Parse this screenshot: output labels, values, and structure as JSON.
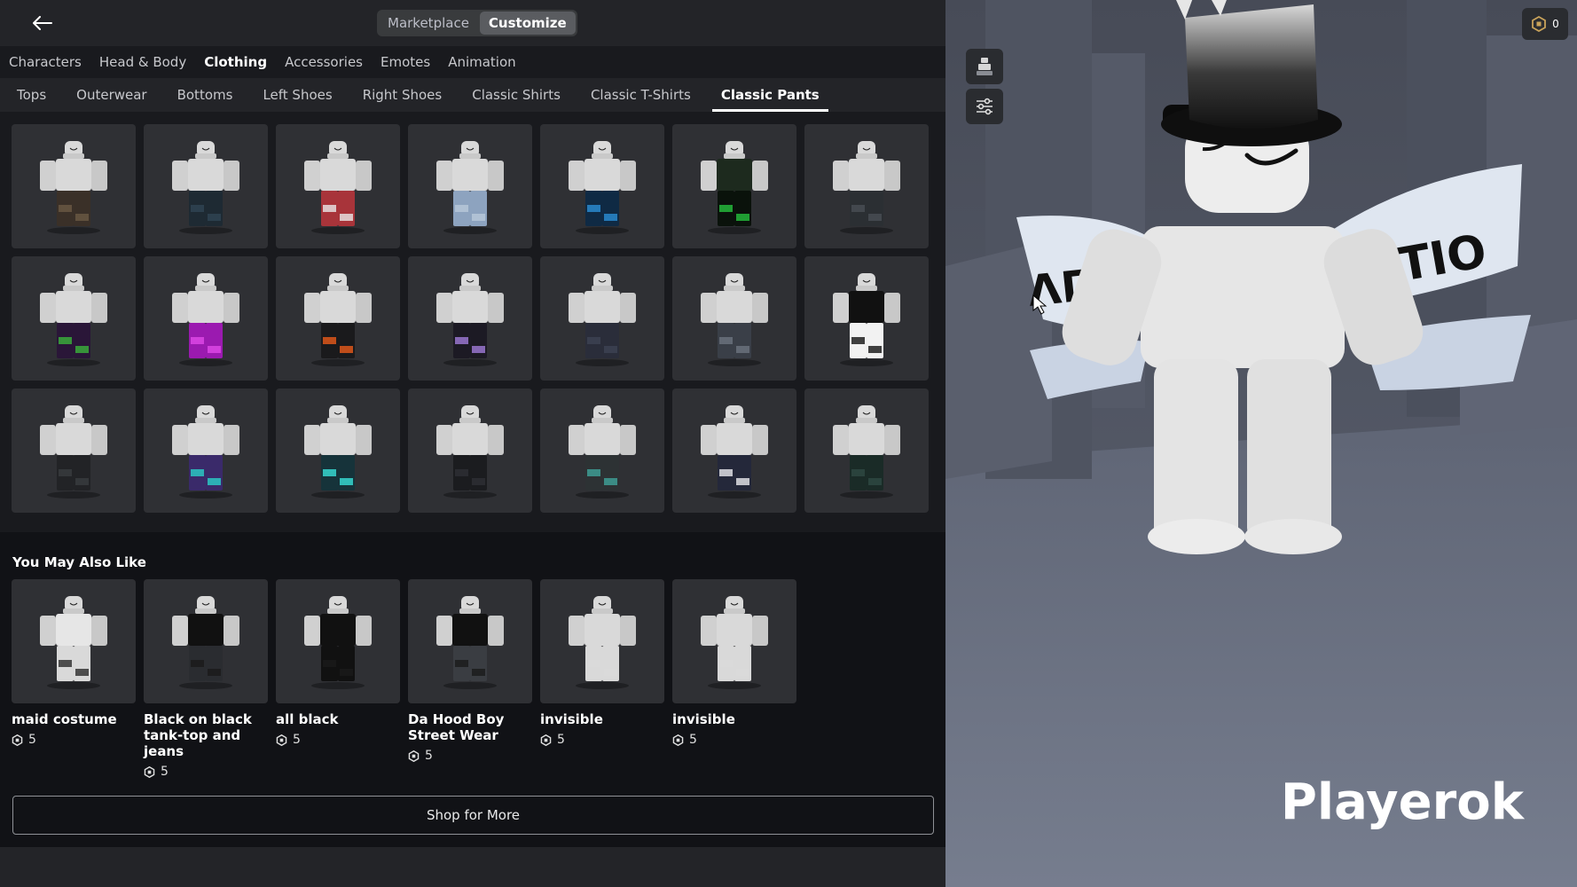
{
  "header": {
    "modes": [
      {
        "label": "Marketplace",
        "active": false
      },
      {
        "label": "Customize",
        "active": true
      }
    ]
  },
  "category_tabs": [
    {
      "label": "Characters",
      "active": false
    },
    {
      "label": "Head & Body",
      "active": false
    },
    {
      "label": "Clothing",
      "active": true
    },
    {
      "label": "Accessories",
      "active": false
    },
    {
      "label": "Emotes",
      "active": false
    },
    {
      "label": "Animation",
      "active": false
    }
  ],
  "sub_tabs": [
    {
      "label": "Tops",
      "active": false
    },
    {
      "label": "Outerwear",
      "active": false
    },
    {
      "label": "Bottoms",
      "active": false
    },
    {
      "label": "Left Shoes",
      "active": false
    },
    {
      "label": "Right Shoes",
      "active": false
    },
    {
      "label": "Classic Shirts",
      "active": false
    },
    {
      "label": "Classic T-Shirts",
      "active": false
    },
    {
      "label": "Classic Pants",
      "active": true
    }
  ],
  "inventory_items": [
    {
      "pants": "#3a3028",
      "accent": "#6b5a44",
      "top": "#d9d9d9"
    },
    {
      "pants": "#1e2a33",
      "accent": "#2f4554",
      "top": "#d9d9d9"
    },
    {
      "pants": "#a8343a",
      "accent": "#e9e9e9",
      "top": "#d9d9d9"
    },
    {
      "pants": "#8da3bf",
      "accent": "#b9c8da",
      "top": "#d9d9d9"
    },
    {
      "pants": "#0f2a44",
      "accent": "#2a8fd6",
      "top": "#d9d9d9"
    },
    {
      "pants": "#0a120b",
      "accent": "#26c23d",
      "top": "#1d2a1e"
    },
    {
      "pants": "#2b2f33",
      "accent": "#4a4f55",
      "top": "#d9d9d9"
    },
    {
      "pants": "#2a1638",
      "accent": "#3bb33b",
      "top": "#d9d9d9"
    },
    {
      "pants": "#9b1ab0",
      "accent": "#e04ae8",
      "top": "#d9d9d9"
    },
    {
      "pants": "#1a1a1c",
      "accent": "#e85a1a",
      "top": "#d9d9d9"
    },
    {
      "pants": "#1c1a24",
      "accent": "#a07ad8",
      "top": "#d9d9d9"
    },
    {
      "pants": "#2a2d3a",
      "accent": "#3d4254",
      "top": "#d9d9d9"
    },
    {
      "pants": "#3a3f48",
      "accent": "#6d7480",
      "top": "#d9d9d9"
    },
    {
      "pants": "#f2f2f2",
      "accent": "#111111",
      "top": "#111111"
    },
    {
      "pants": "#222326",
      "accent": "#3a3c40",
      "top": "#d9d9d9"
    },
    {
      "pants": "#3a2a6a",
      "accent": "#2ad0c8",
      "top": "#d9d9d9"
    },
    {
      "pants": "#16333a",
      "accent": "#38e0d8",
      "top": "#d9d9d9"
    },
    {
      "pants": "#1b1c1f",
      "accent": "#2e3034",
      "top": "#d9d9d9"
    },
    {
      "pants": "#2d3234",
      "accent": "#3fa39a",
      "top": "#d9d9d9"
    },
    {
      "pants": "#24283a",
      "accent": "#e8e8ee",
      "top": "#d9d9d9"
    },
    {
      "pants": "#1a2b27",
      "accent": "#2e4a43",
      "top": "#d9d9d9"
    }
  ],
  "recommendations": {
    "title": "You May Also Like",
    "items": [
      {
        "name": "maid costume",
        "price": "5",
        "pants": "#d9d9d9",
        "accent": "#2a2a2a",
        "top": "#e6e6e6"
      },
      {
        "name": "Black on black tank-top and jeans",
        "price": "5",
        "pants": "#2a2c30",
        "accent": "#1a1a1a",
        "top": "#111111"
      },
      {
        "name": "all black",
        "price": "5",
        "pants": "#111111",
        "accent": "#1a1a1a",
        "top": "#111111"
      },
      {
        "name": "Da Hood Boy Street Wear",
        "price": "5",
        "pants": "#3a3d42",
        "accent": "#1a1a1a",
        "top": "#111111"
      },
      {
        "name": "invisible",
        "price": "5",
        "pants": "#d9d9d9",
        "accent": "#d9d9d9",
        "top": "#d9d9d9"
      },
      {
        "name": "invisible",
        "price": "5",
        "pants": "#d9d9d9",
        "accent": "#d9d9d9",
        "top": "#d9d9d9"
      }
    ],
    "shop_button": "Shop for More"
  },
  "viewport": {
    "robux_balance": "0",
    "player_name": "Playerok"
  },
  "colors": {
    "panel_bg": "#191a1e",
    "bar_bg": "#232428",
    "tile_bg": "#2f3034",
    "active_tab_underline": "#ffffff"
  }
}
